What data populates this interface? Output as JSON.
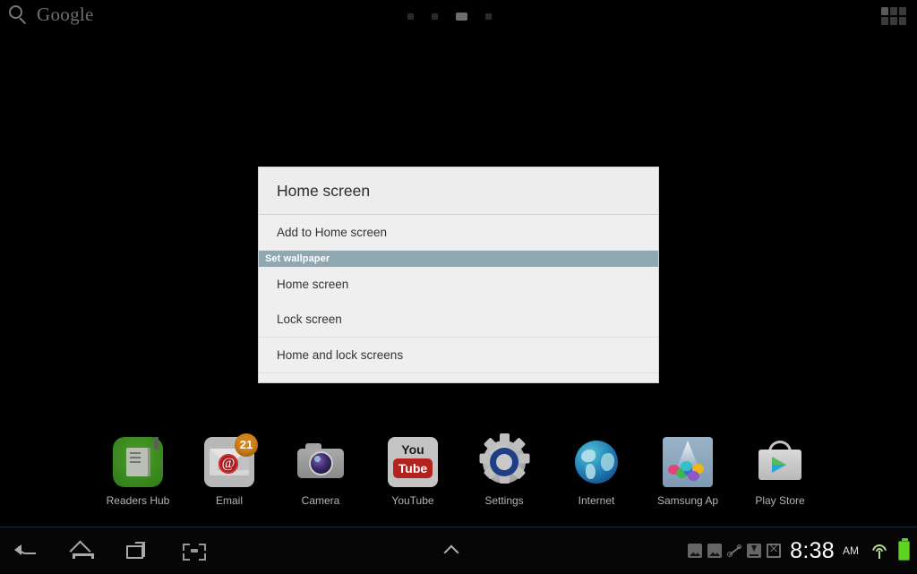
{
  "topbar": {
    "search_label": "Google",
    "search_icon": "search-icon",
    "apps_grid_icon": "apps-grid-icon",
    "page_indicator": {
      "count": 4,
      "active_index": 2
    }
  },
  "dialog": {
    "title": "Home screen",
    "items": [
      {
        "label": "Add to Home screen",
        "type": "item"
      },
      {
        "label": "Set wallpaper",
        "type": "section"
      },
      {
        "label": "Home screen",
        "type": "item"
      },
      {
        "label": "Lock screen",
        "type": "item"
      },
      {
        "label": "Home and lock screens",
        "type": "item"
      }
    ],
    "section_color": "#8fa8b2"
  },
  "dock": {
    "items": [
      {
        "label": "Readers Hub",
        "icon": "readers-hub-icon"
      },
      {
        "label": "Email",
        "icon": "email-icon",
        "badge": "21"
      },
      {
        "label": "Camera",
        "icon": "camera-icon"
      },
      {
        "label": "YouTube",
        "icon": "youtube-icon",
        "text_top": "You",
        "text_bottom": "Tube"
      },
      {
        "label": "Settings",
        "icon": "settings-gear-icon"
      },
      {
        "label": "Internet",
        "icon": "internet-globe-icon"
      },
      {
        "label": "Samsung Ap",
        "icon": "samsung-apps-icon"
      },
      {
        "label": "Play Store",
        "icon": "play-store-icon"
      }
    ]
  },
  "systembar": {
    "nav": [
      {
        "name": "back-icon"
      },
      {
        "name": "home-icon"
      },
      {
        "name": "recents-icon"
      },
      {
        "name": "screenshot-icon"
      }
    ],
    "caret_icon": "chevron-up-icon",
    "status_icons": [
      "screenshot-captured-icon",
      "screenshot-captured-icon",
      "vibrate-mute-icon",
      "download-icon",
      "gmail-icon"
    ],
    "time": "8:38",
    "am_pm": "AM",
    "wifi_icon": "wifi-icon",
    "battery_icon": "battery-full-icon",
    "battery_color": "#5dd41f"
  }
}
